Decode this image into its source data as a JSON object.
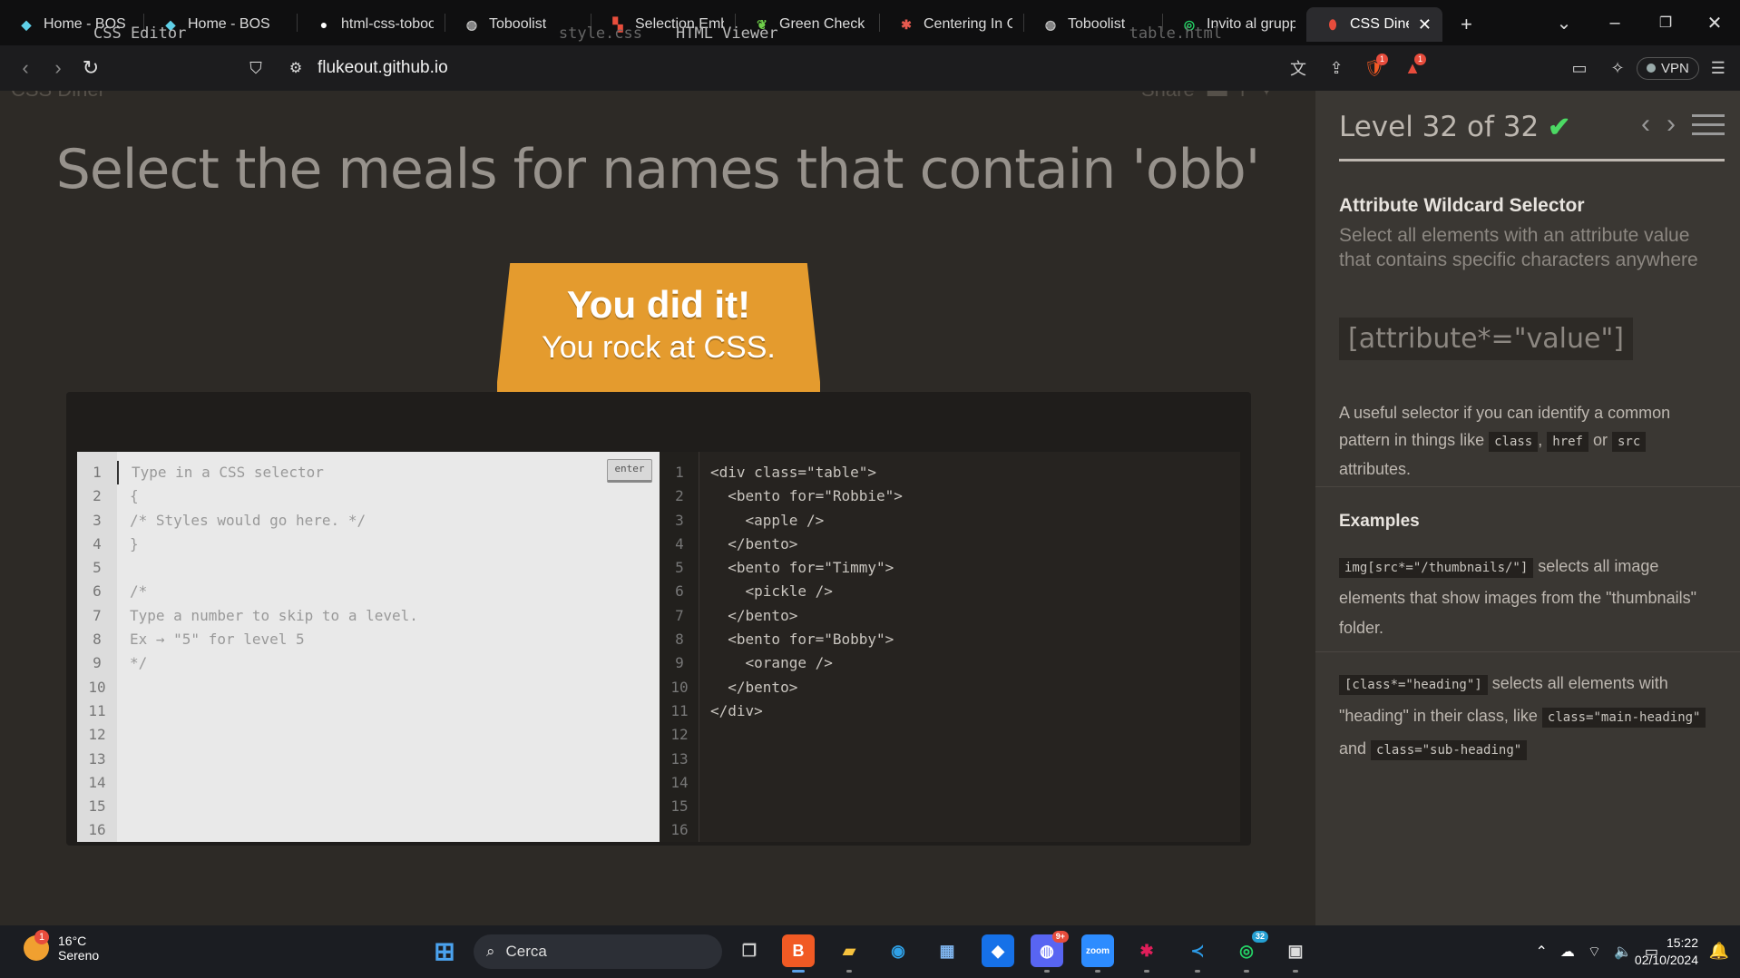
{
  "browser": {
    "tabs": [
      {
        "title": "Home - BOS",
        "icon": "bos-icon",
        "color": "#5fd0e8"
      },
      {
        "title": "Home - BOS",
        "icon": "bos-icon",
        "color": "#5fd0e8"
      },
      {
        "title": "html-css-toboo",
        "icon": "github-icon",
        "color": "#ffffff"
      },
      {
        "title": "Toboolist",
        "icon": "globe-icon",
        "color": "#bbbbbb"
      },
      {
        "title": "Selection Embe",
        "icon": "zoho-icon",
        "color": "#e94e3c"
      },
      {
        "title": "Green Check M",
        "icon": "leaf-icon",
        "color": "#6fcf4a"
      },
      {
        "title": "Centering In CS",
        "icon": "asterisk-icon",
        "color": "#e85a4f"
      },
      {
        "title": "Toboolist",
        "icon": "globe-icon",
        "color": "#bbbbbb"
      },
      {
        "title": "Invito al grupp",
        "icon": "whatsapp-icon",
        "color": "#25d366"
      },
      {
        "title": "CSS Diner",
        "icon": "css-diner-icon",
        "color": "#e74c3c",
        "active": true
      }
    ],
    "new_tab": "+",
    "url": "flukeout.github.io",
    "vpn_label": "VPN",
    "brave_badge": "1",
    "rewards_badge": "1"
  },
  "page": {
    "logo_fragment": "CSS Diner",
    "share_fragment": "Share",
    "headline": "Select the meals for names that contain 'obb'",
    "table_big": "You did it!",
    "table_small": "You rock at CSS.",
    "css_editor": {
      "title": "CSS Editor",
      "file": "style.css",
      "enter": "enter",
      "lines": [
        "Type in a CSS selector",
        "{",
        "/* Styles would go here. */",
        "}",
        "",
        "/*",
        "Type a number to skip to a level.",
        "Ex → \"5\" for level 5",
        "*/",
        "",
        "",
        "",
        "",
        "",
        "",
        ""
      ]
    },
    "html_viewer": {
      "title": "HTML Viewer",
      "file": "table.html",
      "lines": [
        "<div class=\"table\">",
        "  <bento for=\"Robbie\">",
        "    <apple />",
        "  </bento>",
        "  <bento for=\"Timmy\">",
        "    <pickle />",
        "  </bento>",
        "  <bento for=\"Bobby\">",
        "    <orange />",
        "  </bento>",
        "</div>",
        "",
        "",
        "",
        "",
        ""
      ]
    }
  },
  "sidebar": {
    "level": "Level 32 of 32",
    "check": "✔",
    "title": "Attribute Wildcard Selector",
    "subtitle": "Select all elements with an attribute value that contains specific characters anywhere",
    "syntax": "[attribute*=\"value\"]",
    "para1_a": "A useful selector if you can identify a common pattern in things like ",
    "para1_code1": "class",
    "para1_sep": ", ",
    "para1_code2": "href",
    "para1_or": " or ",
    "para1_code3": "src",
    "para1_b": " attributes.",
    "examples_title": "Examples",
    "ex1_code": "img[src*=\"/thumbnails/\"]",
    "ex1_text": " selects all image elements that show images from the \"thumbnails\" folder.",
    "ex2_code": "[class*=\"heading\"]",
    "ex2_text_a": " selects all elements with \"heading\" in their class, like ",
    "ex2_code2": "class=\"main-heading\"",
    "ex2_and": " and ",
    "ex2_code3": "class=\"sub-heading\""
  },
  "taskbar": {
    "weather_temp": "16°C",
    "weather_desc": "Sereno",
    "weather_badge": "1",
    "search_label": "Cerca",
    "discord_badge": "9+",
    "whatsapp_badge": "32",
    "time": "15:22",
    "date": "02/10/2024"
  }
}
